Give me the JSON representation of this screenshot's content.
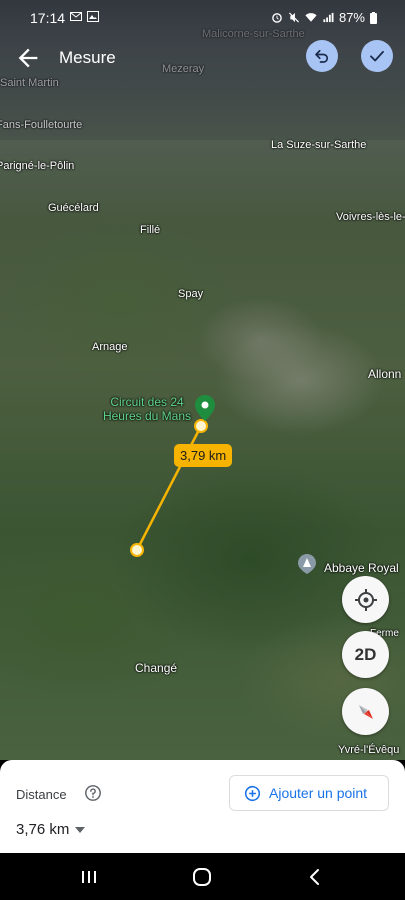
{
  "status_bar": {
    "time": "17:14",
    "battery": "87%",
    "icons_left": [
      "mail-icon",
      "image-icon"
    ],
    "icons_right": [
      "alarm-icon",
      "mute-icon",
      "wifi-icon",
      "signal-icon",
      "battery-icon"
    ]
  },
  "toolbar": {
    "title": "Mesure",
    "back_icon": "arrow-back-icon",
    "undo_icon": "undo-icon",
    "done_icon": "check-icon"
  },
  "map": {
    "places": [
      "Malicorne-sur-Sarthe",
      "Mezeray",
      "Saint Martin",
      "Fans-Foulletourte",
      "Parigné-le-Pôlin",
      "La Suze-sur-Sarthe",
      "Voivres-lès-le-M",
      "Guécélard",
      "Fillé",
      "Spay",
      "Arnage",
      "Allonn",
      "Changé",
      "Yvré-l'Évêqu",
      "Ferme",
      "Abbaye Royal"
    ],
    "poi_label": "Circuit des 24 Heures du Mans",
    "measure_label": "3,79 km"
  },
  "controls": {
    "mode_label": "2D",
    "locate_icon": "my-location-icon",
    "compass_icon": "compass-icon"
  },
  "bottom_sheet": {
    "distance_title": "Distance",
    "distance_value": "3,76 km",
    "add_point_label": "Ajouter un point"
  },
  "navbar": {
    "icons": [
      "recent-apps-icon",
      "home-icon",
      "back-nav-icon"
    ]
  },
  "colors": {
    "accent_blue": "#1a73e8",
    "measure_yellow": "#f6b400",
    "pin_green": "#1e8e3e",
    "top_button_bg": "#a8c4f4"
  }
}
